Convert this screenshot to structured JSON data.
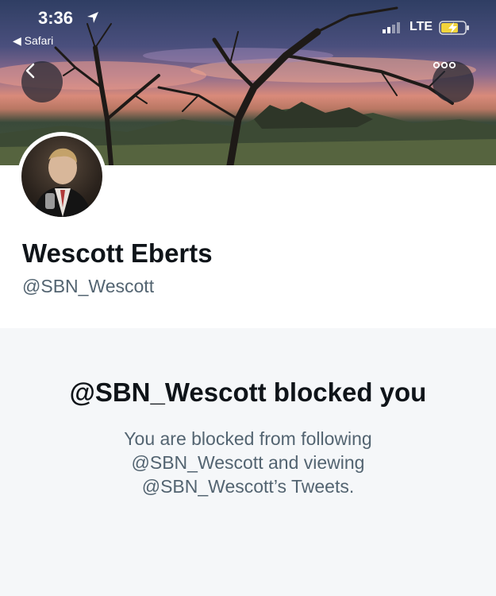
{
  "status_bar": {
    "time": "3:36",
    "back_app": "◀ Safari",
    "network": "LTE"
  },
  "profile": {
    "display_name": "Wescott Eberts",
    "handle": "@SBN_Wescott"
  },
  "blocked": {
    "title": "@SBN_Wescott blocked you",
    "description": "You are blocked from following @SBN_Wescott and viewing @SBN_Wescott’s Tweets."
  },
  "icons": {
    "back": "chevron-left-icon",
    "more": "more-horizontal-icon",
    "location": "location-arrow-icon",
    "battery": "battery-charging-icon",
    "signal": "signal-bars-icon"
  },
  "colors": {
    "text_primary": "#0f1419",
    "text_secondary": "#536471",
    "battery_charge": "#f2d43b"
  }
}
